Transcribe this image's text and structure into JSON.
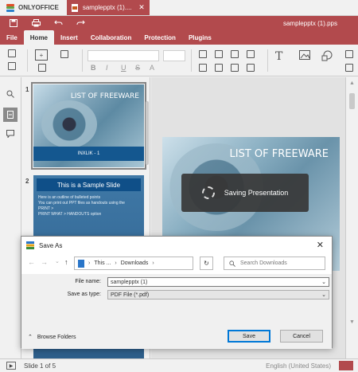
{
  "tabbar": {
    "app_name": "ONLYOFFICE",
    "doc_tab": "samplepptx (1)....",
    "close": "✕"
  },
  "header": {
    "doc_title": "samplepptx (1).pps",
    "menu": [
      "File",
      "Home",
      "Insert",
      "Collaboration",
      "Protection",
      "Plugins"
    ]
  },
  "thumbs": {
    "slide1_num": "1",
    "slide1_title": "LIST OF FREEWARE",
    "slide1_band": "INXLIK - 1",
    "slide2_num": "2",
    "slide2_title": "This is a Sample Slide",
    "slide2_bullets": [
      "Here is an outline of bulleted points",
      "You can print out PPT files as handouts using the",
      "PRINT >",
      "PRINT WHAT > HANDOUTS option"
    ]
  },
  "slide": {
    "title": "LIST OF FREEWARE",
    "status": "Saving Presentation"
  },
  "status": {
    "slide_of": "Slide 1 of 5",
    "language": "English (United States)"
  },
  "dialog": {
    "title": "Save As",
    "path": [
      "This ...",
      "Downloads"
    ],
    "search_placeholder": "Search Downloads",
    "file_name_label": "File name:",
    "file_name_value": "samplepptx (1)",
    "save_type_label": "Save as type:",
    "save_type_value": "PDF File (*.pdf)",
    "browse_label": "Browse Folders",
    "save_button": "Save",
    "cancel_button": "Cancel"
  },
  "colors": {
    "brand": "#b24a4d",
    "slide_band": "#14578f",
    "dialog_focus": "#0078d7"
  }
}
